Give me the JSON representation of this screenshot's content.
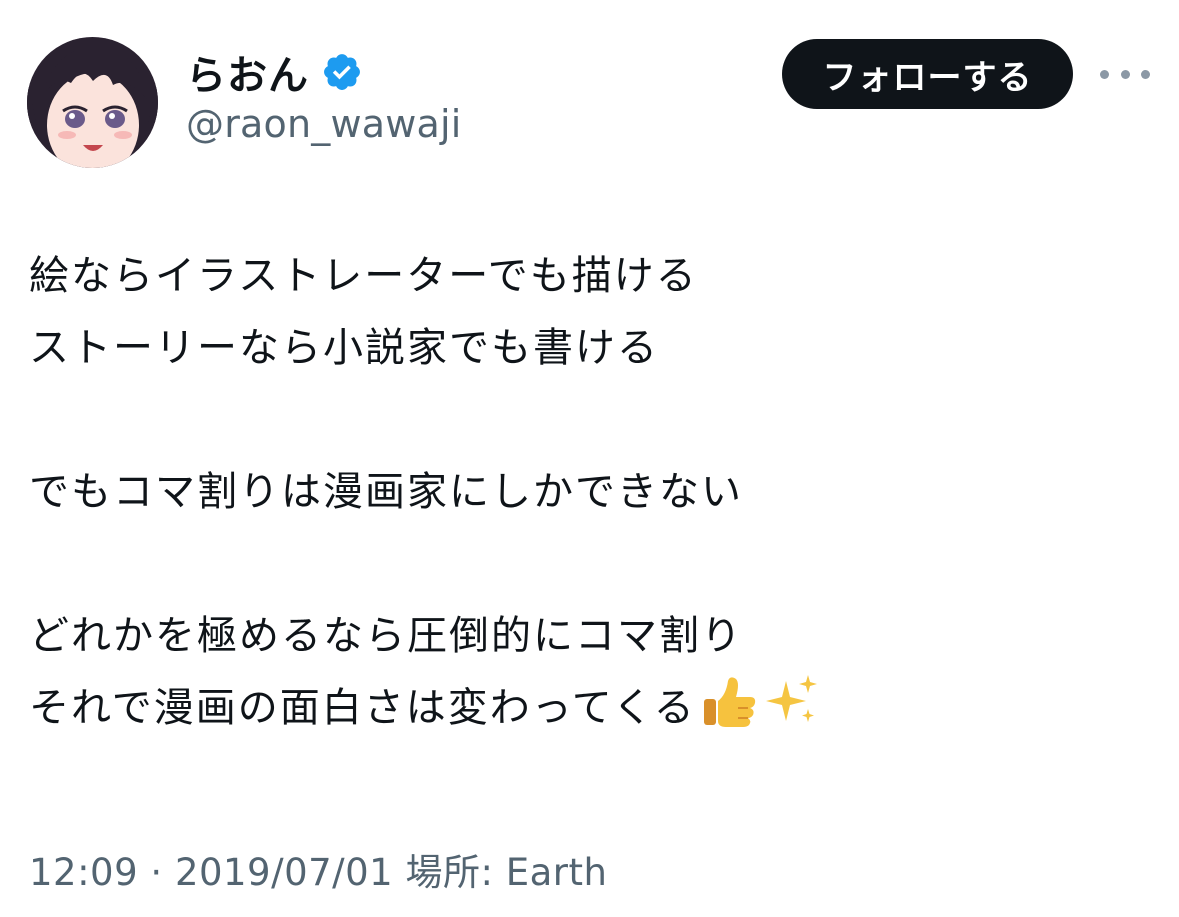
{
  "author": {
    "display_name": "らおん",
    "handle": "@raon_wawaji",
    "verified_icon": "verified-badge-icon",
    "avatar_icon": "anime-girl-avatar"
  },
  "actions": {
    "follow_label": "フォローする",
    "more_icon": "more-options-icon"
  },
  "tweet": {
    "lines": [
      "絵ならイラストレーターでも描ける",
      "ストーリーなら小説家でも書ける",
      "",
      "でもコマ割りは漫画家にしかできない",
      "",
      "どれかを極めるなら圧倒的にコマ割り",
      "それで漫画の面白さは変わってくる"
    ],
    "trailing_emoji": [
      "thumbs-up-emoji",
      "sparkles-emoji"
    ]
  },
  "meta": {
    "time": "12:09",
    "separator": " · ",
    "date": "2019/07/01",
    "location": " 場所: Earth"
  },
  "colors": {
    "text": "#0f1419",
    "secondary": "#536471",
    "verified": "#1d9bf0",
    "follow_bg": "#0f1419"
  }
}
